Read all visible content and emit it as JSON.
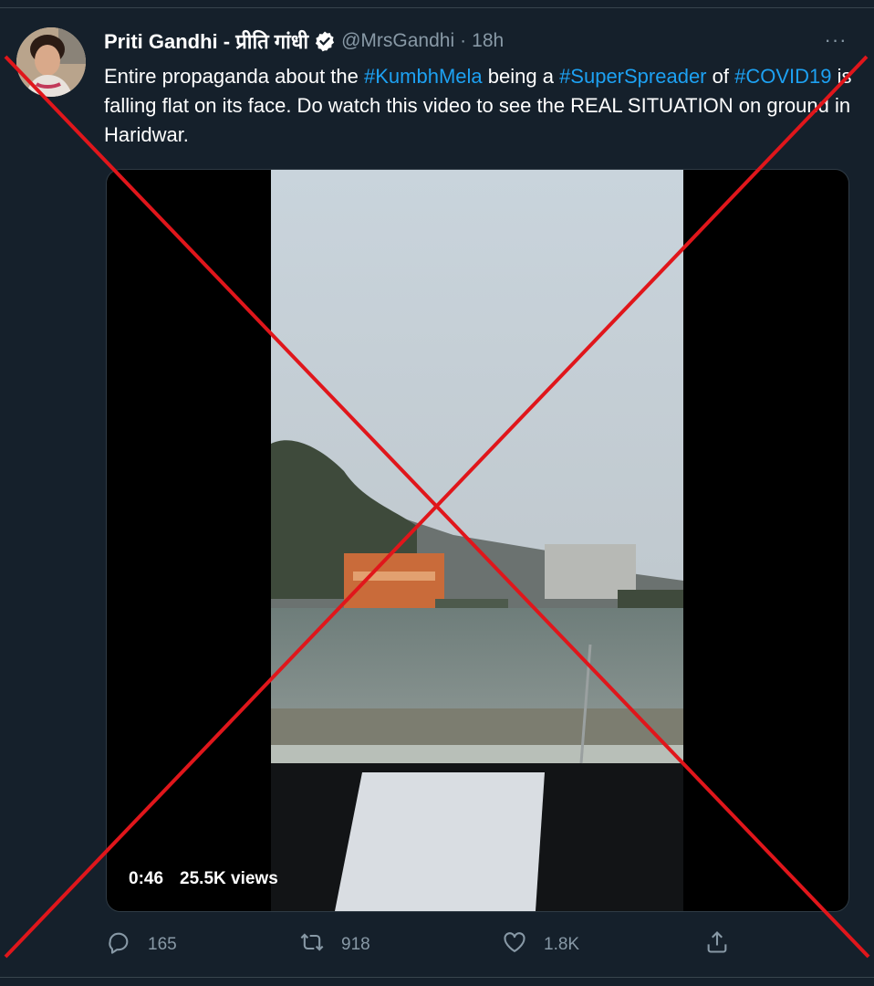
{
  "tweet": {
    "author_name": "Priti Gandhi - प्रीति गांधी",
    "handle": "@MrsGandhi",
    "separator": "·",
    "time": "18h",
    "more_label": "···",
    "text_segments": [
      {
        "text": "Entire propaganda about the ",
        "hashtag": false
      },
      {
        "text": "#KumbhMela",
        "hashtag": true
      },
      {
        "text": " being a ",
        "hashtag": false
      },
      {
        "text": "#SuperSpreader",
        "hashtag": true
      },
      {
        "text": " of ",
        "hashtag": false
      },
      {
        "text": "#COVID19",
        "hashtag": true
      },
      {
        "text": " is falling flat on its face. Do watch this video to see the REAL SITUATION on ground in Haridwar.",
        "hashtag": false
      }
    ],
    "hashtag_color": "#1da1f2"
  },
  "video": {
    "duration": "0:46",
    "views": "25.5K views"
  },
  "actions": {
    "replies": "165",
    "retweets": "918",
    "likes": "1.8K"
  },
  "icons": {
    "verified": "verified-badge-icon",
    "reply": "reply-icon",
    "retweet": "retweet-icon",
    "like": "heart-icon",
    "share": "share-icon"
  },
  "overlay_color": "#e0161b"
}
